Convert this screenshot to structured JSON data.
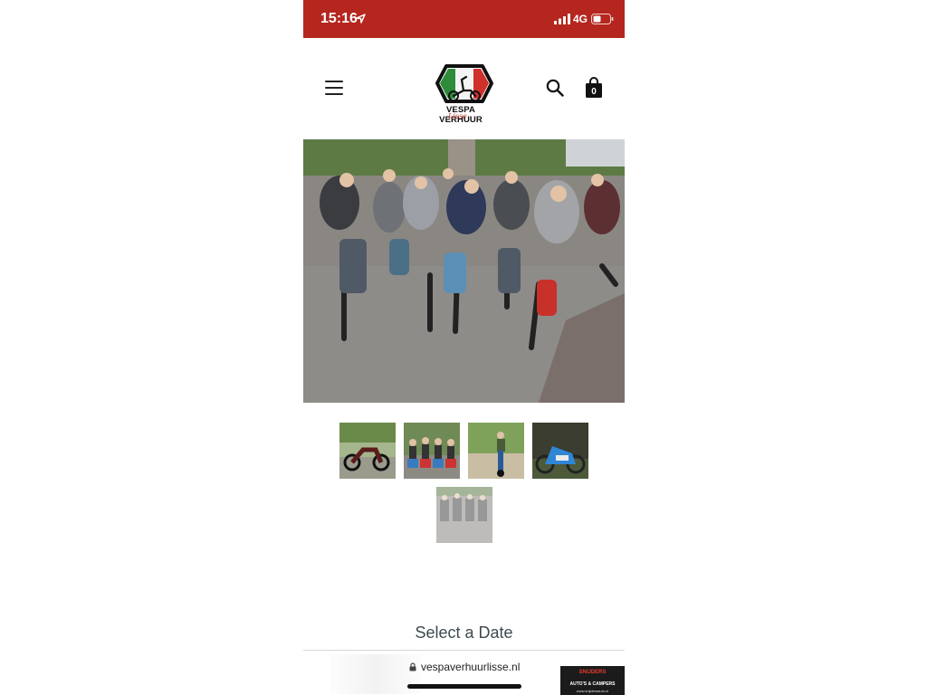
{
  "status_bar": {
    "time": "15:16",
    "network": "4G",
    "background_color": "#b5261e"
  },
  "header": {
    "brand_name": "VESPA VERHUUR",
    "brand_script": "Lisse",
    "cart_count": "0",
    "icons": [
      "menu-icon",
      "search-icon",
      "cart-icon"
    ]
  },
  "gallery": {
    "thumbnail_count": 5,
    "selected_index": 5
  },
  "booking": {
    "select_date_label": "Select a Date"
  },
  "browser": {
    "url": "vespaverhuurlisse.nl"
  },
  "ad": {
    "title": "SNIJDERS",
    "subtitle": "AUTO'S & CAMPERS",
    "url": "www.snijdersauto.nl"
  }
}
